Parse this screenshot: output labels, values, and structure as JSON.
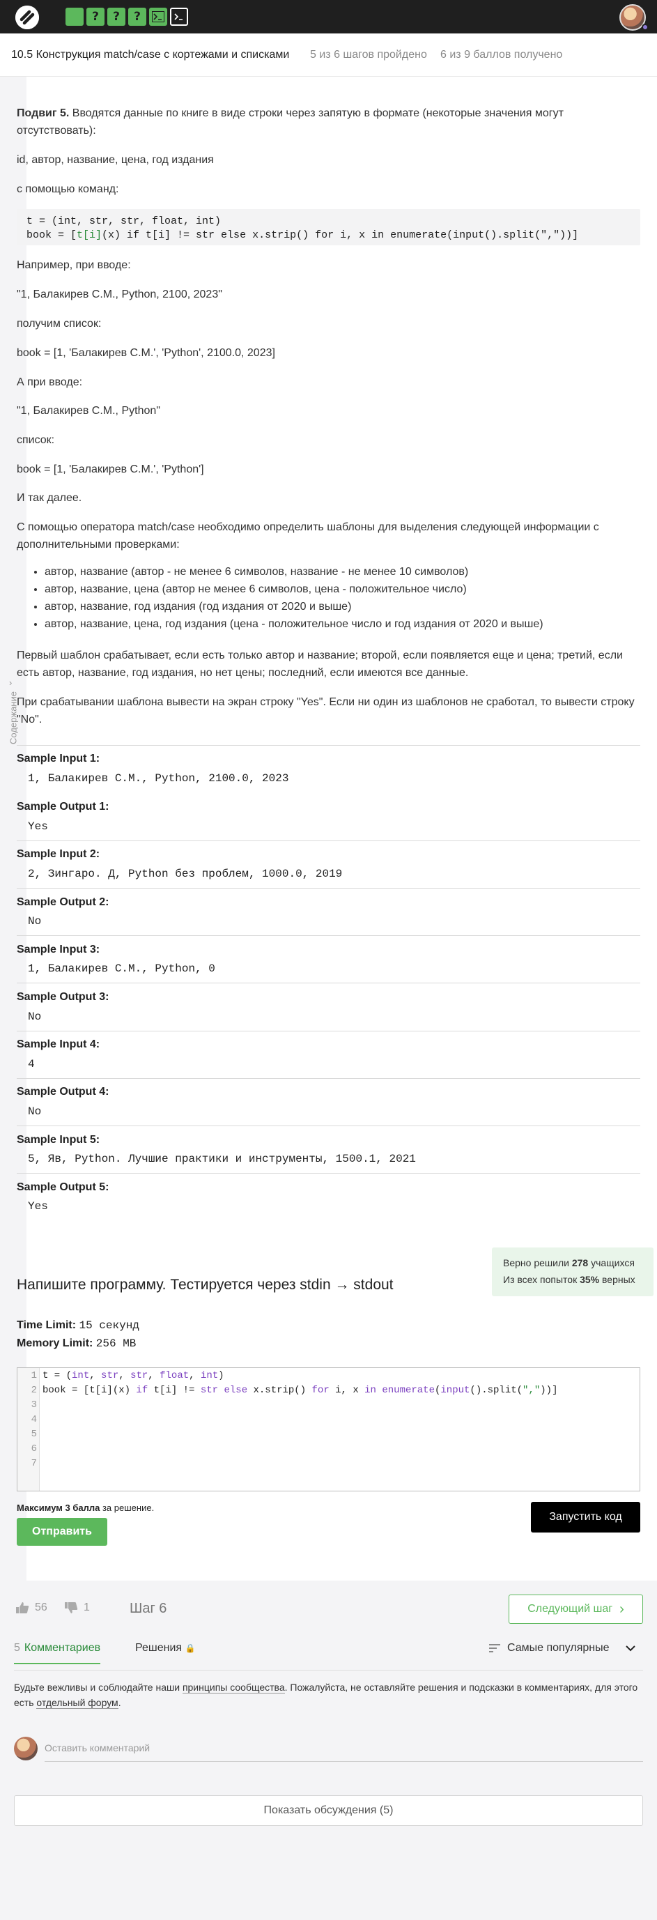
{
  "topbar": {
    "logo_icon": "stepik-logo-icon",
    "steps": [
      "done",
      "?",
      "?",
      "?",
      "code",
      "current"
    ]
  },
  "lesson": {
    "title": "10.5 Конструкция match/case с кортежами и списками",
    "progress_steps": "5 из 6 шагов пройдено",
    "progress_points": "6 из 9 баллов  получено"
  },
  "sidebar": {
    "label": "Содержание"
  },
  "problem": {
    "intro_bold": "Подвиг 5.",
    "intro": " Вводятся данные по книге в виде строки через запятую в формате (некоторые значения могут отсутствовать):",
    "format": "id, автор, название, цена, год издания",
    "with_commands": "с помощью команд:",
    "code_line1": "t = (int, str, str, float, int)",
    "code_line2_a": "book = [",
    "code_line2_b": "t[i]",
    "code_line2_c": "(x) if t[i] != str else x.strip() for i, x in enumerate(input().split(\",\"))]",
    "example_intro": "Например, при вводе:",
    "example1_input": "\"1, Балакирев С.М., Python, 2100, 2023\"",
    "get_list": "получим список:",
    "example1_list": "book = [1, 'Балакирев С.М.', 'Python', 2100.0, 2023]",
    "and_input": "А при вводе:",
    "example2_input": "\"1, Балакирев С.М., Python\"",
    "list_word": "список:",
    "example2_list": "book = [1, 'Балакирев С.М.', 'Python']",
    "and_so_on": "И так далее.",
    "task": "С помощью оператора match/case необходимо определить шаблоны для выделения следующей информации с дополнительными проверками:",
    "bullets": [
      "автор, название (автор - не менее 6 символов, название - не менее 10 символов)",
      "автор, название, цена (автор не менее 6 символов, цена - положительное число)",
      "автор, название, год издания (год издания от 2020 и выше)",
      "автор, название, цена, год издания (цена - положительное число и год издания от 2020 и выше)"
    ],
    "rule1": "Первый шаблон срабатывает, если есть только автор и название; второй, если появляется еще и цена; третий, если есть автор, название, год издания, но нет цены; последний, если имеются все данные.",
    "rule2": "При срабатывании шаблона вывести на экран строку \"Yes\". Если ни один из шаблонов не сработал, то вывести строку \"No\"."
  },
  "samples": [
    {
      "label": "Sample Input 1:",
      "value": "1, Балакирев С.М., Python, 2100.0, 2023"
    },
    {
      "label": "Sample Output 1:",
      "value": "Yes"
    },
    {
      "label": "Sample Input 2:",
      "value": "2, Зингаро. Д, Python без проблем, 1000.0, 2019"
    },
    {
      "label": "Sample Output 2:",
      "value": "No"
    },
    {
      "label": "Sample Input 3:",
      "value": "1, Балакирев С.М., Python, 0"
    },
    {
      "label": "Sample Output 3:",
      "value": "No"
    },
    {
      "label": "Sample Input 4:",
      "value": "4"
    },
    {
      "label": "Sample Output 4:",
      "value": "No"
    },
    {
      "label": "Sample Input 5:",
      "value": "5, Яв, Python. Лучшие практики и инструменты, 1500.1, 2021"
    },
    {
      "label": "Sample Output 5:",
      "value": "Yes"
    }
  ],
  "stats": {
    "solved_pre": "Верно решили ",
    "solved_num": "278",
    "solved_post": " учащихся",
    "attempts_pre": "Из всех попыток ",
    "attempts_num": "35%",
    "attempts_post": " верных"
  },
  "task_header": "Напишите программу. Тестируется через stdin → stdout",
  "limits": {
    "time_label": "Time Limit:",
    "time_value": "15 секунд",
    "memory_label": "Memory Limit:",
    "memory_value": "256 MB"
  },
  "editor": {
    "line_numbers": [
      "1",
      "2",
      "3",
      "4",
      "5",
      "6",
      "7"
    ]
  },
  "submit": {
    "max_bold": "Максимум 3 балла",
    "max_rest": " за решение.",
    "send_label": "Отправить",
    "run_label": "Запустить код"
  },
  "footer": {
    "likes": "56",
    "dislikes": "1",
    "step_label": "Шаг 6",
    "next_label": "Следующий шаг",
    "comments_count": "5",
    "comments_tab": "Комментариев",
    "solutions_tab": "Решения",
    "sort_label": "Самые популярные",
    "rules_a": "Будьте вежливы и соблюдайте наши ",
    "rules_link1": "принципы сообщества",
    "rules_b": ". Пожалуйста, не оставляйте решения и подсказки в комментариях, для этого есть ",
    "rules_link2": "отдельный форум",
    "rules_c": ".",
    "comment_placeholder": "Оставить комментарий",
    "show_discussion": "Показать обсуждения (5)"
  },
  "colors": {
    "accent": "#5cb85c",
    "topbar": "#1f1f1f",
    "stats_bg": "#e9f5ea"
  }
}
